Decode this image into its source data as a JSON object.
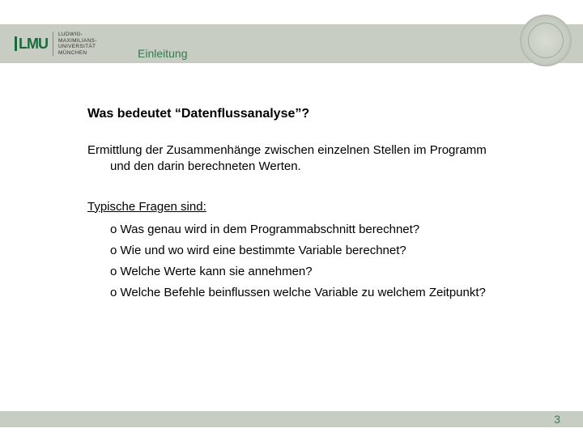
{
  "logo": {
    "mark": "LMU",
    "line1": "LUDWIG-",
    "line2": "MAXIMILIANS-",
    "line3": "UNIVERSITÄT",
    "line4": "MÜNCHEN"
  },
  "section_title": "Einleitung",
  "heading": "Was bedeutet “Datenflussanalyse”?",
  "paragraph_line1": "Ermittlung der Zusammenhänge zwischen einzelnen Stellen im Programm",
  "paragraph_line2": "und den darin berechneten Werten.",
  "subheading": "Typische Fragen sind:",
  "questions": [
    "Was genau wird in dem Programmabschnitt berechnet?",
    "Wie und wo wird eine bestimmte Variable berechnet?",
    "Welche Werte kann sie annehmen?",
    "Welche Befehle beinflussen welche Variable zu welchem Zeitpunkt?"
  ],
  "page_number": "3"
}
